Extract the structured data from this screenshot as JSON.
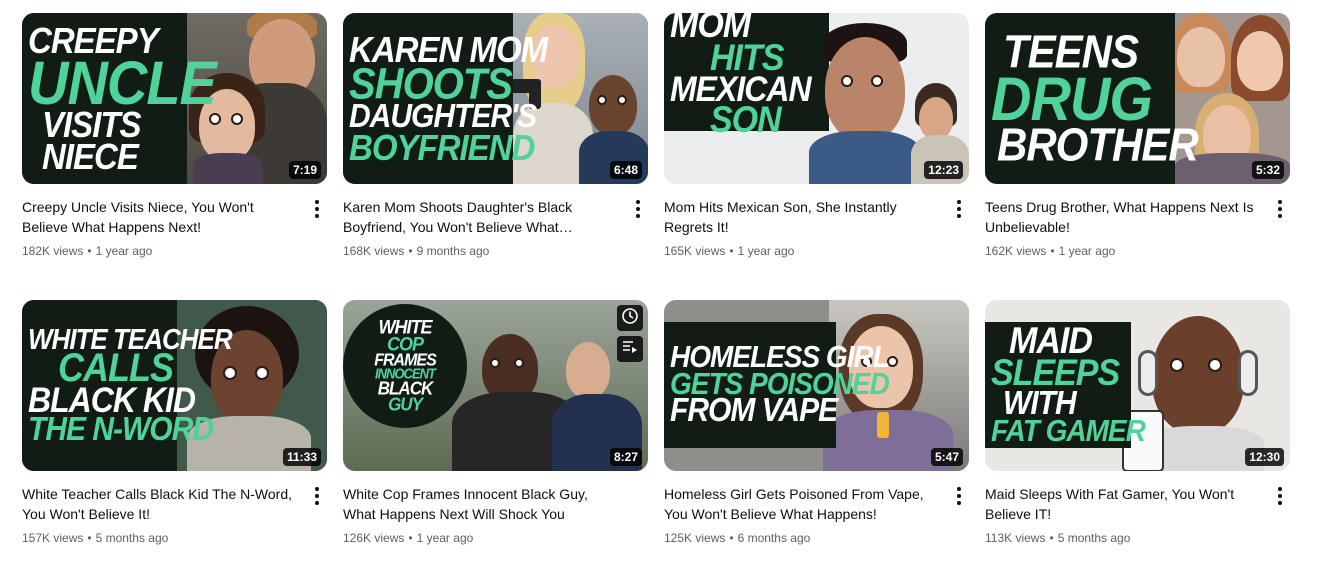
{
  "colors": {
    "accent_green": "#4fd39a",
    "panel_dark": "#111d14",
    "meta_gray": "#606060"
  },
  "videos": [
    {
      "thumb_lines": [
        {
          "text": "CREEPY",
          "color": "white"
        },
        {
          "text": "UNCLE",
          "color": "green"
        },
        {
          "text": "VISITS",
          "color": "white"
        },
        {
          "text": "NIECE",
          "color": "white"
        }
      ],
      "duration": "7:19",
      "title": "Creepy Uncle Visits Niece, You Won't Believe What Happens Next!",
      "views": "182K views",
      "age": "1 year ago"
    },
    {
      "thumb_lines": [
        {
          "text": "KAREN MOM",
          "color": "white"
        },
        {
          "text": "SHOOTS",
          "color": "green"
        },
        {
          "text": "DAUGHTER'S",
          "color": "white"
        },
        {
          "text": "BOYFRIEND",
          "color": "green"
        }
      ],
      "duration": "6:48",
      "title": "Karen Mom Shoots Daughter's Black Boyfriend, You Won't Believe What Happen...",
      "views": "168K views",
      "age": "9 months ago"
    },
    {
      "thumb_lines": [
        {
          "text": "MOM",
          "color": "white"
        },
        {
          "text": "HITS",
          "color": "green"
        },
        {
          "text": "MEXICAN",
          "color": "white"
        },
        {
          "text": "SON",
          "color": "green"
        }
      ],
      "duration": "12:23",
      "title": "Mom Hits Mexican Son, She Instantly Regrets It!",
      "views": "165K views",
      "age": "1 year ago"
    },
    {
      "thumb_lines": [
        {
          "text": "TEENS",
          "color": "white"
        },
        {
          "text": "DRUG",
          "color": "green"
        },
        {
          "text": "BROTHER",
          "color": "white"
        }
      ],
      "duration": "5:32",
      "title": "Teens Drug Brother, What Happens Next Is Unbelievable!",
      "views": "162K views",
      "age": "1 year ago"
    },
    {
      "thumb_lines": [
        {
          "text": "WHITE TEACHER",
          "color": "white"
        },
        {
          "text": "CALLS",
          "color": "green"
        },
        {
          "text": "BLACK KID",
          "color": "white"
        },
        {
          "text": "THE N-WORD",
          "color": "green"
        }
      ],
      "duration": "11:33",
      "title": "White Teacher Calls Black Kid The N-Word, You Won't Believe It!",
      "views": "157K views",
      "age": "5 months ago"
    },
    {
      "thumb_lines": [
        {
          "text": "WHITE",
          "color": "white"
        },
        {
          "text": "COP",
          "color": "green"
        },
        {
          "text": "FRAMES",
          "color": "white"
        },
        {
          "text": "INNOCENT",
          "color": "green"
        },
        {
          "text": "BLACK",
          "color": "white"
        },
        {
          "text": "GUY",
          "color": "green"
        }
      ],
      "duration": "8:27",
      "hover_icons": [
        "clock-icon",
        "add-to-queue-icon"
      ],
      "title": "White Cop Frames Innocent Black Guy, What Happens Next Will Shock You",
      "views": "126K views",
      "age": "1 year ago"
    },
    {
      "thumb_lines": [
        {
          "text": "HOMELESS GIRL",
          "color": "white"
        },
        {
          "text": "GETS POISONED",
          "color": "green"
        },
        {
          "text": "FROM VAPE",
          "color": "white"
        }
      ],
      "duration": "5:47",
      "title": "Homeless Girl Gets Poisoned From Vape, You Won't Believe What Happens!",
      "views": "125K views",
      "age": "6 months ago"
    },
    {
      "thumb_lines": [
        {
          "text": "MAID",
          "color": "white"
        },
        {
          "text": "SLEEPS",
          "color": "green"
        },
        {
          "text": "WITH",
          "color": "white"
        },
        {
          "text": "FAT GAMER",
          "color": "green"
        }
      ],
      "duration": "12:30",
      "title": "Maid Sleeps With Fat Gamer, You Won't Believe IT!",
      "views": "113K views",
      "age": "5 months ago"
    }
  ]
}
